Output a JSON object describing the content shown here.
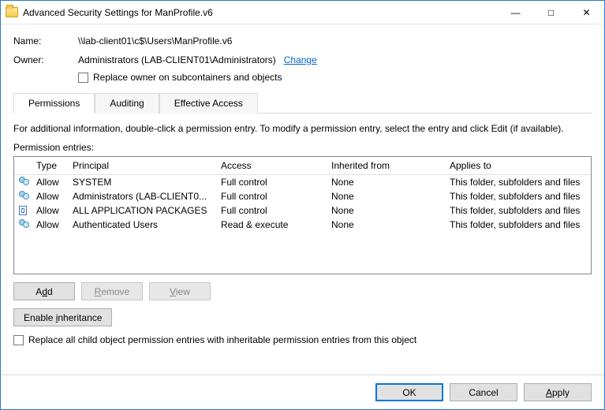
{
  "titlebar": {
    "title": "Advanced Security Settings for ManProfile.v6"
  },
  "fields": {
    "name_label": "Name:",
    "name_value": "\\\\lab-client01\\c$\\Users\\ManProfile.v6",
    "owner_label": "Owner:",
    "owner_value": "Administrators (LAB-CLIENT01\\Administrators)",
    "change_link": "Change",
    "replace_owner_label": "Replace owner on subcontainers and objects"
  },
  "tabs": {
    "permissions": "Permissions",
    "auditing": "Auditing",
    "effective": "Effective Access"
  },
  "info_text": "For additional information, double-click a permission entry. To modify a permission entry, select the entry and click Edit (if available).",
  "entries_label": "Permission entries:",
  "columns": {
    "type": "Type",
    "principal": "Principal",
    "access": "Access",
    "inherited": "Inherited from",
    "applies": "Applies to"
  },
  "entries": [
    {
      "icon": "group",
      "type": "Allow",
      "principal": "SYSTEM",
      "access": "Full control",
      "inherited": "None",
      "applies": "This folder, subfolders and files"
    },
    {
      "icon": "group",
      "type": "Allow",
      "principal": "Administrators (LAB-CLIENT0...",
      "access": "Full control",
      "inherited": "None",
      "applies": "This folder, subfolders and files"
    },
    {
      "icon": "pkg",
      "type": "Allow",
      "principal": "ALL APPLICATION PACKAGES",
      "access": "Full control",
      "inherited": "None",
      "applies": "This folder, subfolders and files"
    },
    {
      "icon": "group",
      "type": "Allow",
      "principal": "Authenticated Users",
      "access": "Read & execute",
      "inherited": "None",
      "applies": "This folder, subfolders and files"
    }
  ],
  "buttons": {
    "add": "Add",
    "remove": "Remove",
    "view": "View",
    "enable_inh": "Enable inheritance",
    "ok": "OK",
    "cancel": "Cancel",
    "apply": "Apply"
  },
  "replace_all_label": "Replace all child object permission entries with inheritable permission entries from this object"
}
